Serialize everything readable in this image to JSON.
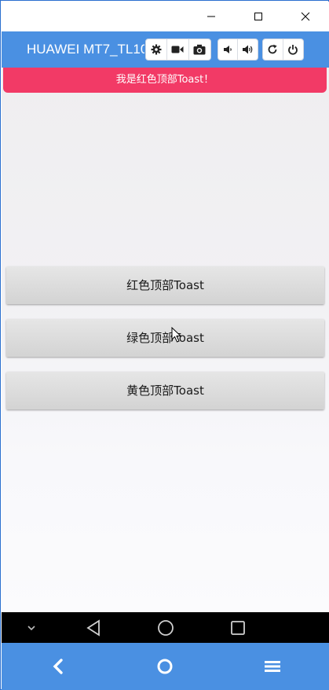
{
  "device": {
    "name": "HUAWEI MT7_TL10"
  },
  "toolbar": {
    "group1": [
      "gear-icon",
      "video-camera-icon",
      "camera-icon"
    ],
    "group2": [
      "volume-down-icon",
      "volume-up-icon"
    ],
    "group3": [
      "rotate-icon",
      "power-icon"
    ]
  },
  "toast": {
    "text": "我是红色顶部Toast！",
    "color": "#f23a66"
  },
  "buttons": {
    "red": "红色顶部Toast",
    "green": "绿色顶部Toast",
    "yellow": "黄色顶部Toast"
  },
  "colors": {
    "accent": "#4a90e2"
  }
}
